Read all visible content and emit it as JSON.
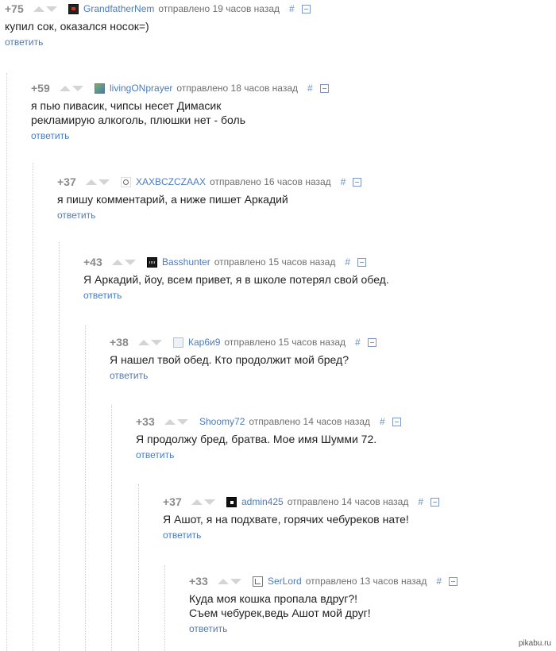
{
  "comments": [
    {
      "score": "+75",
      "author": "GrandfatherNem",
      "time": "отправлено 19 часов назад",
      "hash": "#",
      "lines": [
        "купил сок, оказался носок=)"
      ],
      "reply": "ответить"
    },
    {
      "score": "+59",
      "author": "livingONprayer",
      "time": "отправлено 18 часов назад",
      "hash": "#",
      "lines": [
        "я пью пивасик, чипсы несет Димасик",
        "рекламирую алкоголь, плюшки нет - боль"
      ],
      "reply": "ответить"
    },
    {
      "score": "+37",
      "author": "XAXBCZCZAAX",
      "time": "отправлено 16 часов назад",
      "hash": "#",
      "lines": [
        "я пишу комментарий, а ниже пишет Аркадий"
      ],
      "reply": "ответить"
    },
    {
      "score": "+43",
      "author": "Basshunter",
      "time": "отправлено 15 часов назад",
      "hash": "#",
      "lines": [
        "Я Аркадий, йоу, всем привет, я в школе потерял свой обед."
      ],
      "reply": "ответить"
    },
    {
      "score": "+38",
      "author": "Кар6и9",
      "time": "отправлено 15 часов назад",
      "hash": "#",
      "lines": [
        "Я нашел твой обед. Кто продолжит мой бред?"
      ],
      "reply": "ответить"
    },
    {
      "score": "+33",
      "author": "Shoomy72",
      "time": "отправлено 14 часов назад",
      "hash": "#",
      "lines": [
        "Я продолжу бред, братва. Мое имя Шумми 72."
      ],
      "reply": "ответить"
    },
    {
      "score": "+37",
      "author": "admin425",
      "time": "отправлено 14 часов назад",
      "hash": "#",
      "lines": [
        "Я Ашот, я на подхвате, горячих чебуреков нате!"
      ],
      "reply": "ответить"
    },
    {
      "score": "+33",
      "author": "SerLord",
      "time": "отправлено 13 часов назад",
      "hash": "#",
      "lines": [
        "Куда моя кошка пропала вдруг?!",
        "Съем чебурек,ведь Ашот мой друг!"
      ],
      "reply": "ответить"
    }
  ],
  "watermark": "pikabu.ru",
  "colors": {
    "link": "#4a7bbf",
    "score": "#8a8a8a",
    "arrow": "#d4d4d4"
  }
}
